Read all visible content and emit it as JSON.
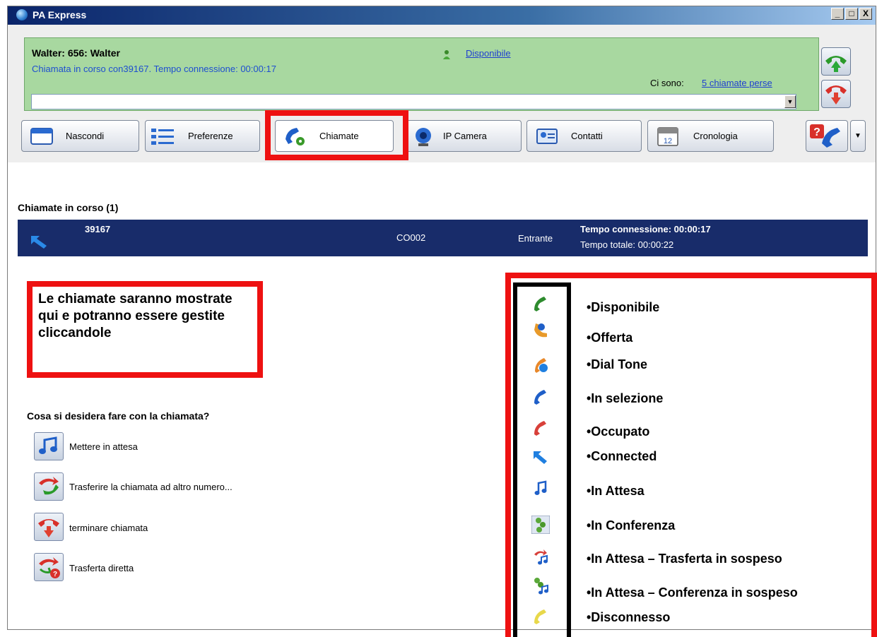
{
  "window": {
    "title": "PA Express",
    "controls": [
      "_",
      "□",
      "X"
    ]
  },
  "status": {
    "user": "Walter: 656: Walter",
    "call_info": "Chiamata in corso con39167. Tempo connessione: 00:00:17",
    "presence": "Disponibile",
    "missed_prefix": "Ci sono:",
    "missed_link": "5 chiamate perse",
    "dial_value": ""
  },
  "tabs": [
    {
      "label": "Nascondi"
    },
    {
      "label": "Preferenze"
    },
    {
      "label": "Chiamate"
    },
    {
      "label": "IP Camera"
    },
    {
      "label": "Contatti"
    },
    {
      "label": "Cronologia"
    }
  ],
  "calls": {
    "heading": "Chiamate in corso (1)",
    "rows": [
      {
        "number": "39167",
        "line": "CO002",
        "direction": "Entrante",
        "connection": "Tempo connessione: 00:00:17",
        "total": "Tempo totale: 00:00:22"
      }
    ]
  },
  "info_note": "Le chiamate saranno mostrate qui e potranno essere gestite cliccandole",
  "actions": {
    "heading": "Cosa si desidera fare con la chiamata?",
    "items": [
      {
        "label": "Mettere in attesa",
        "icon": "music-note-icon"
      },
      {
        "label": "Trasferire la chiamata ad altro numero...",
        "icon": "transfer-icon"
      },
      {
        "label": "terminare chiamata",
        "icon": "hangup-icon"
      },
      {
        "label": "Trasferta diretta",
        "icon": "direct-transfer-icon"
      }
    ]
  },
  "legend": [
    {
      "label": "•Disponibile",
      "icon": "green-handset-icon",
      "color": "#2e8b2e"
    },
    {
      "label": "•Offerta",
      "icon": "offered-call-icon",
      "color": "#e89a2a"
    },
    {
      "label": "•Dial Tone",
      "icon": "dial-tone-icon",
      "color": "#e8882a"
    },
    {
      "label": "•In selezione",
      "icon": "blue-handset-icon",
      "color": "#1f5fc8"
    },
    {
      "label": "•Occupato",
      "icon": "red-handset-icon",
      "color": "#d8403a"
    },
    {
      "label": "•Connected",
      "icon": "connected-arrow-icon",
      "color": "#1f7fe0"
    },
    {
      "label": "•In Attesa",
      "icon": "music-note-icon",
      "color": "#1f5fc8"
    },
    {
      "label": "•In Conferenza",
      "icon": "conference-icon",
      "color": "#5aa83a"
    },
    {
      "label": "•In Attesa – Trasferta in sospeso",
      "icon": "hold-transfer-icon",
      "color": "#d8403a"
    },
    {
      "label": "•In Attesa – Conferenza in sospeso",
      "icon": "hold-conference-icon",
      "color": "#5aa83a"
    },
    {
      "label": "•Disconnesso",
      "icon": "disconnected-handset-icon",
      "color": "#e8d84a"
    }
  ]
}
